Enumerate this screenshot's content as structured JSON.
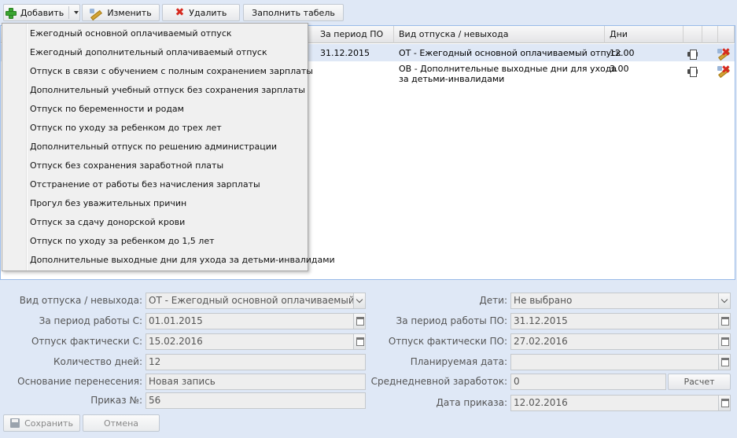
{
  "toolbar": {
    "add_label": "Добавить",
    "edit_label": "Изменить",
    "delete_label": "Удалить",
    "fill_label": "Заполнить табель"
  },
  "grid": {
    "columns": [
      "За период ПО",
      "Вид отпуска / невыхода",
      "Дни"
    ],
    "rows": [
      {
        "period_to": "31.12.2015",
        "type": "ОТ - Ежегодный основной оплачиваемый отпуск",
        "days": "12.00"
      },
      {
        "period_to": "",
        "type_line1": "ОВ - Дополнительные выходные дни для ухода",
        "type_line2": "за детьми-инвалидами",
        "days": "3.00"
      }
    ]
  },
  "menu": {
    "items": [
      "Ежегодный основной оплачиваемый отпуск",
      "Ежегодный дополнительный оплачиваемый отпуск",
      "Отпуск в связи с обучением с полным сохранением зарплаты",
      "Дополнительный учебный отпуск без сохранения зарплаты",
      "Отпуск по беременности и родам",
      "Отпуск по уходу за ребенком до трех лет",
      "Дополнительный отпуск по решению администрации",
      "Отпуск без сохранения заработной платы",
      "Отстранение от работы без начисления зарплаты",
      "Прогул без уважительных причин",
      "Отпуск за сдачу донорской крови",
      "Отпуск по уходу за ребенком до 1,5 лет",
      "Дополнительные выходные дни для ухода за детьми-инвалидами"
    ]
  },
  "form": {
    "leave_type_label": "Вид отпуска / невыхода:",
    "leave_type_value": "ОТ - Ежегодный основной оплачиваемый отп",
    "period_from_label": "За период работы С:",
    "period_from_value": "01.01.2015",
    "actual_from_label": "Отпуск фактически С:",
    "actual_from_value": "15.02.2016",
    "days_label": "Количество дней:",
    "days_value": "12",
    "reason_label": "Основание перенесения:",
    "reason_value": "Новая запись",
    "order_no_label": "Приказ №:",
    "order_no_value": "56",
    "children_label": "Дети:",
    "children_value": "Не выбрано",
    "period_to_label": "За период работы ПО:",
    "period_to_value": "31.12.2015",
    "actual_to_label": "Отпуск фактически ПО:",
    "actual_to_value": "27.02.2016",
    "planned_label": "Планируемая дата:",
    "planned_value": "",
    "avg_label": "Среднедневной заработок:",
    "avg_value": "0",
    "calc_label": "Расчет",
    "order_date_label": "Дата приказа:",
    "order_date_value": "12.02.2016"
  },
  "bottom": {
    "save_label": "Сохранить",
    "cancel_label": "Отмена"
  }
}
